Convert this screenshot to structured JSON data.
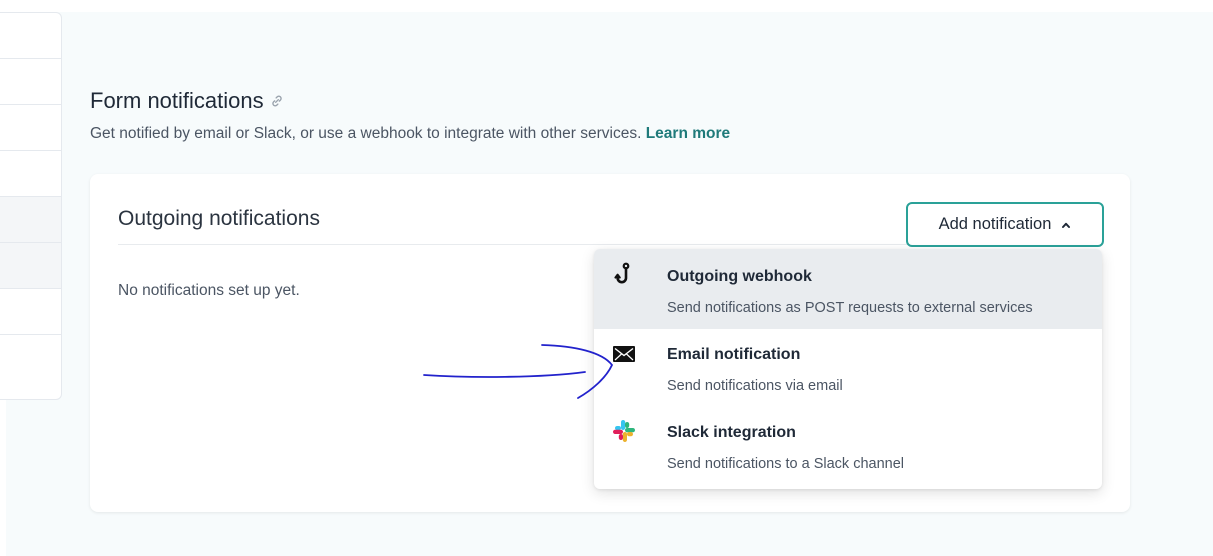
{
  "section": {
    "title": "Form notifications",
    "description": "Get notified by email or Slack, or use a webhook to integrate with other services.",
    "learn_more": "Learn more"
  },
  "card": {
    "title": "Outgoing notifications",
    "empty_text": "No notifications set up yet.",
    "add_button": "Add notification"
  },
  "dropdown": {
    "items": [
      {
        "title": "Outgoing webhook",
        "desc": "Send notifications as POST requests to external services",
        "icon": "webhook-hook-icon"
      },
      {
        "title": "Email notification",
        "desc": "Send notifications via email",
        "icon": "envelope-icon"
      },
      {
        "title": "Slack integration",
        "desc": "Send notifications to a Slack channel",
        "icon": "slack-icon"
      }
    ]
  },
  "colors": {
    "accent": "#2aa198",
    "link": "#1f7a7a",
    "hover": "#e9ecef",
    "annotation": "#2222cc"
  }
}
